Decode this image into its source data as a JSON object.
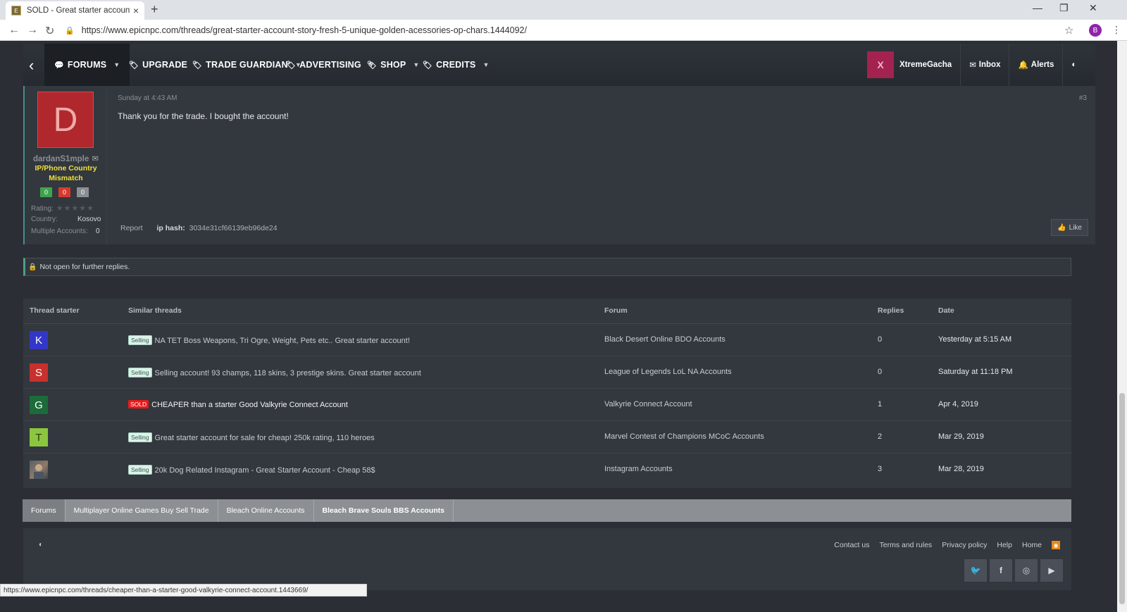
{
  "browser": {
    "tab_title": "SOLD - Great starter account, sto",
    "url": "https://www.epicnpc.com/threads/great-starter-account-story-fresh-5-unique-golden-acessories-op-chars.1444092/",
    "profile_initial": "B",
    "status_url": "https://www.epicnpc.com/threads/cheaper-than-a-starter-good-valkyrie-connect-account.1443669/"
  },
  "nav": {
    "items": [
      {
        "label": "FORUMS"
      },
      {
        "label": "UPGRADE"
      },
      {
        "label": "TRADE GUARDIAN"
      },
      {
        "label": "ADVERTISING"
      },
      {
        "label": "SHOP"
      },
      {
        "label": "CREDITS"
      }
    ],
    "avatar_letter": "X",
    "username": "XtremeGacha",
    "inbox": "Inbox",
    "alerts": "Alerts"
  },
  "post": {
    "avatar_letter": "D",
    "username": "dardanS1mple",
    "user_title": "IP/Phone Country Mismatch",
    "badges": [
      "0",
      "0",
      "0"
    ],
    "rating_label": "Rating:",
    "country_label": "Country:",
    "country_value": "Kosovo",
    "multi_label": "Multiple Accounts:",
    "multi_value": "0",
    "date": "Sunday at 4:43 AM",
    "number": "#3",
    "body": "Thank you for the trade. I bought the account!",
    "report": "Report",
    "ip_label": "ip hash:",
    "ip_value": "3034e31cf66139eb96de24",
    "like": "Like"
  },
  "notice": "Not open for further replies.",
  "similar": {
    "headers": {
      "starter": "Thread starter",
      "threads": "Similar threads",
      "forum": "Forum",
      "replies": "Replies",
      "date": "Date"
    },
    "rows": [
      {
        "letter": "K",
        "color": "#3337c8",
        "tag": "Selling",
        "title": "NA TET Boss Weapons, Tri Ogre, Weight, Pets etc.. Great starter account!",
        "forum": "Black Desert Online BDO Accounts",
        "replies": "0",
        "date": "Yesterday at 5:15 AM"
      },
      {
        "letter": "S",
        "color": "#c8302d",
        "tag": "Selling",
        "title": "Selling account! 93 champs, 118 skins, 3 prestige skins. Great starter account",
        "forum": "League of Legends LoL NA Accounts",
        "replies": "0",
        "date": "Saturday at 11:18 PM"
      },
      {
        "letter": "G",
        "color": "#1c6b3a",
        "tag": "SOLD",
        "title": "CHEAPER than a starter Good Valkyrie Connect Account",
        "forum": "Valkyrie Connect Account",
        "replies": "1",
        "date": "Apr 4, 2019"
      },
      {
        "letter": "T",
        "color": "#8cc63f",
        "tag": "Selling",
        "title": "Great starter account for sale for cheap! 250k rating, 110 heroes",
        "forum": "Marvel Contest of Champions MCoC Accounts",
        "replies": "2",
        "date": "Mar 29, 2019"
      },
      {
        "letter": "",
        "color": "#6a6e73",
        "tag": "Selling",
        "title": "20k Dog Related Instagram - Great Starter Account - Cheap 58$",
        "forum": "Instagram Accounts",
        "replies": "3",
        "date": "Mar 28, 2019"
      }
    ]
  },
  "breadcrumbs": [
    "Forums",
    "Multiplayer Online Games Buy Sell Trade",
    "Bleach Online Accounts",
    "Bleach Brave Souls BBS Accounts"
  ],
  "footer": {
    "links": [
      "Contact us",
      "Terms and rules",
      "Privacy policy",
      "Help",
      "Home"
    ]
  }
}
